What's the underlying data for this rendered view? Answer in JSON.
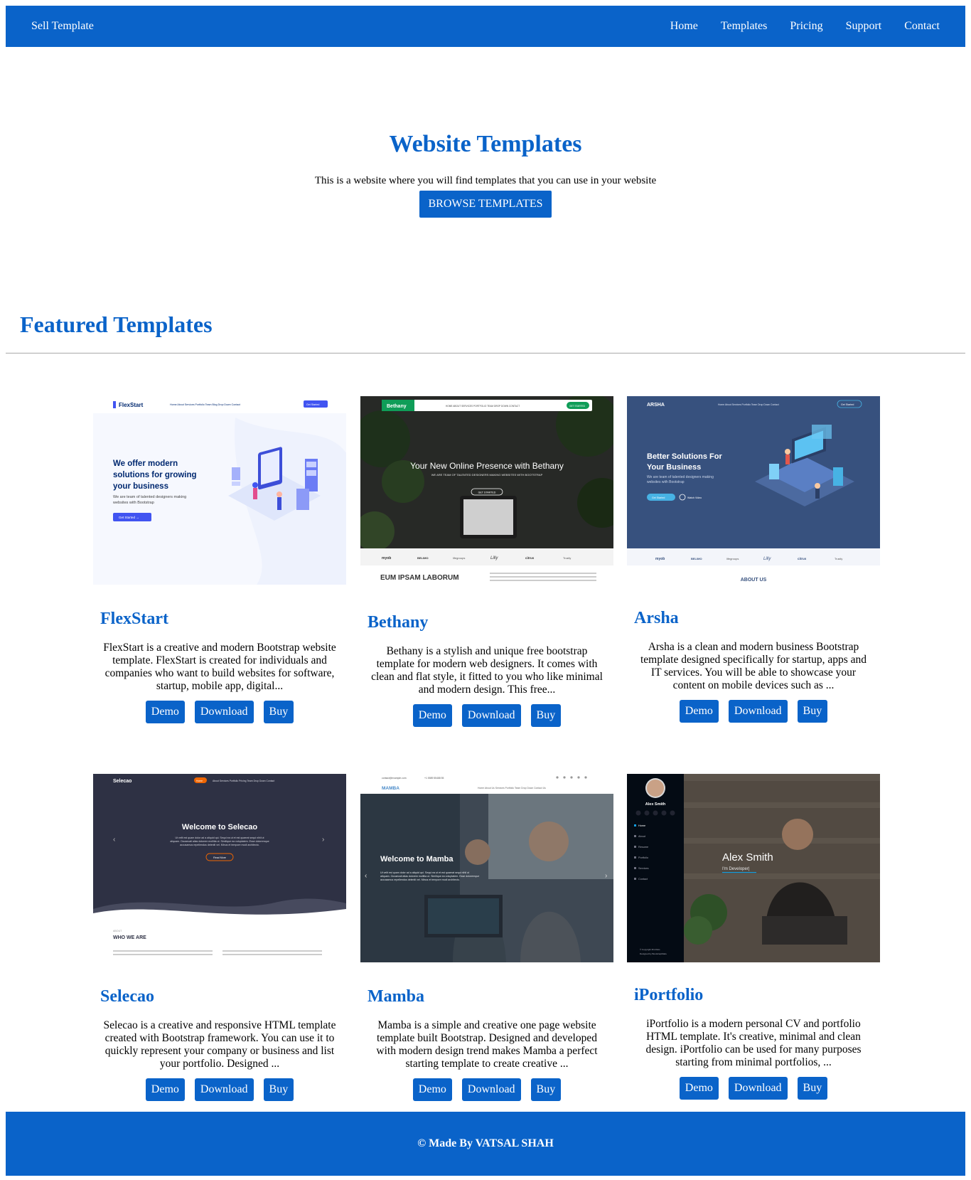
{
  "nav": {
    "brand": "Sell Template",
    "links": [
      "Home",
      "Templates",
      "Pricing",
      "Support",
      "Contact"
    ]
  },
  "hero": {
    "title": "Website Templates",
    "subtitle": "This is a website where you will find templates that you can use in your website",
    "button": "BROWSE TEMPLATES"
  },
  "featured": {
    "title": "Featured Templates",
    "templates": [
      {
        "name": "FlexStart",
        "description": "FlexStart is a creative and modern Bootstrap website template. FlexStart is created for individuals and companies who want to build websites for software, startup, mobile app, digital...",
        "actions": [
          "Demo",
          "Download",
          "Buy"
        ],
        "preview": {
          "logo": "FlexStart",
          "menu": "Home   About   Services   Portfolio   Team   Blog   Drop Down   Contact",
          "cta": "Get Started",
          "headline": [
            "We offer modern",
            "solutions for growing",
            "your business"
          ],
          "sub": [
            "We are team of talented designers making",
            "websites with Bootstrap"
          ],
          "button": "Get Started →"
        }
      },
      {
        "name": "Bethany",
        "description": "Bethany is a stylish and unique free bootstrap template for modern web designers. It comes with clean and flat style, it fitted to you who like minimal and modern design. This free...",
        "actions": [
          "Demo",
          "Download",
          "Buy"
        ],
        "preview": {
          "logo": "Bethany",
          "menu": "HOME   ABOUT   SERVICES   PORTFOLIO   TEAM   DROP DOWN   CONTACT",
          "cta": "GET STARTED",
          "headline": "Your New Online Presence with Bethany",
          "sub": "WE ARE TEAM OF TALENTED DESIGNERS MAKING WEBSITES WITH BOOTSTRAP",
          "button": "GET STARTED",
          "clients": [
            "myob",
            "BELIMO",
            "lifegroups",
            "Lilly",
            "citrus",
            "Trustly"
          ],
          "section": "EUM IPSAM LABORUM"
        }
      },
      {
        "name": "Arsha",
        "description": "Arsha is a clean and modern business Bootstrap template designed specifically for startup, apps and IT services. You will be able to showcase your content on mobile devices such as ...",
        "actions": [
          "Demo",
          "Download",
          "Buy"
        ],
        "preview": {
          "logo": "ARSHA",
          "menu": "Home   About   Services   Portfolio   Team   Drop Down   Contact",
          "cta": "Get Started",
          "headline": [
            "Better Solutions For",
            "Your Business"
          ],
          "sub": [
            "We are team of talented designers making",
            "websites with Bootstrap"
          ],
          "button": "Get Started",
          "video": "Watch Video",
          "clients": [
            "myob",
            "BELIMO",
            "lifegroups",
            "Lilly",
            "citrus",
            "Trustly"
          ],
          "section": "ABOUT US"
        }
      },
      {
        "name": "Selecao",
        "description": "Selecao is a creative and responsive HTML template created with Bootstrap framework. You can use it to quickly represent your company or business and list your portfolio. Designed ...",
        "actions": [
          "Demo",
          "Download",
          "Buy"
        ],
        "preview": {
          "logo": "Selecao",
          "menu": "About   Services   Portfolio   Pricing   Team   Drop Down   Contact",
          "active": "Home",
          "headline": "Welcome to Selecao",
          "sub": [
            "Ut velit est quam dolor ad a aliquid qui. Sequi ea ut et est quaerat sequi nihil ut",
            "aliquam. Occaecati alias dolorem mollitia ut. Similique ea voluptatem. Esse doloremque",
            "accusamus repellendus deleniti vel. Minus et tempore modi architecto."
          ],
          "button": "Read More",
          "eyebrow": "ABOUT",
          "section": "WHO WE ARE"
        }
      },
      {
        "name": "Mamba",
        "description": "Mamba is a simple and creative one page website template built Bootstrap. Designed and developed with modern design trend makes Mamba a perfect starting template to create creative ...",
        "actions": [
          "Demo",
          "Download",
          "Buy"
        ],
        "preview": {
          "email": "contact@example.com",
          "phone": "+1 5589 55488 55",
          "logo": "MAMBA",
          "menu": "Home   About Us   Services   Portfolio   Team   Drop Down   Contact Us",
          "headline": "Welcome to Mamba",
          "sub": [
            "Ut velit est quam dolor ad a aliquid qui. Sequi ea ut et est quaerat sequi nihil ut",
            "aliquam. Occaecati alias dolorem mollitia ut. Similique ea voluptatem. Esse doloremque",
            "accusamus repellendus deleniti vel. Minus et tempore modi architecto."
          ]
        }
      },
      {
        "name": "iPortfolio",
        "description": "iPortfolio is a modern personal CV and portfolio HTML template. It's creative, minimal and clean design. iPortfolio can be used for many purposes starting from minimal portfolios, ...",
        "actions": [
          "Demo",
          "Download",
          "Buy"
        ],
        "preview": {
          "person": "Alex Smith",
          "menu": [
            "Home",
            "About",
            "Resume",
            "Portfolio",
            "Services",
            "Contact"
          ],
          "headline": "Alex Smith",
          "sub": "I'm Developer|",
          "copyright": "© Copyright iPortfolio",
          "credit": "Designed by BootstrapMade"
        }
      }
    ]
  },
  "footer": {
    "text": "© Made By VATSAL SHAH"
  },
  "colors": {
    "primary": "#0a63c9",
    "divider": "#a9a9a9"
  }
}
